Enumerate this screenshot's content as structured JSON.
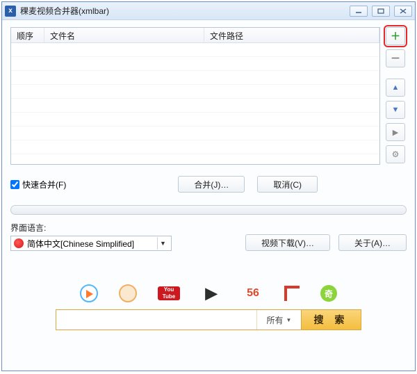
{
  "window": {
    "title": "稞麦视频合并器(xmlbar)"
  },
  "table": {
    "headers": {
      "order": "顺序",
      "filename": "文件名",
      "filepath": "文件路径"
    }
  },
  "sidebtns": {
    "add": "＋",
    "remove": "－",
    "up": "▲",
    "down": "▼",
    "play": "▶",
    "gear": "⚙"
  },
  "options": {
    "fast_merge": "快速合并(F)",
    "merge_btn": "合并(J)…",
    "cancel_btn": "取消(C)"
  },
  "lang": {
    "label": "界面语言:",
    "value": "简体中文[Chinese Simplified]"
  },
  "buttons": {
    "download": "视频下载(V)…",
    "about": "关于(A)…"
  },
  "brands": {
    "youtube": "You Tube",
    "icon4": "▶",
    "icon5": "56",
    "icon7": "奇"
  },
  "search": {
    "placeholder": "",
    "category": "所有",
    "btn": "搜 索"
  }
}
